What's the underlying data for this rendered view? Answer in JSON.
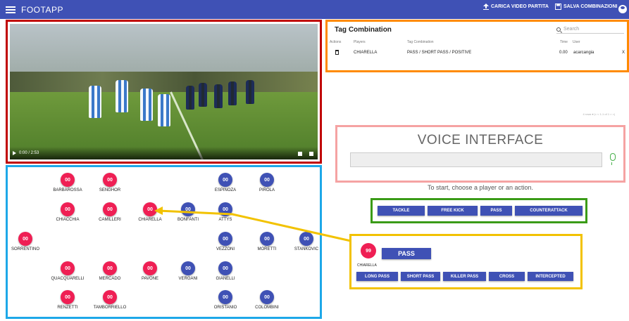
{
  "app": {
    "title": "FOOTAPP",
    "upload_label": "CARICA VIDEO PARTITA",
    "save_label": "SALVA COMBINAZIONI"
  },
  "video": {
    "time": "0:00 / 2:53"
  },
  "tag_table": {
    "title": "Tag Combination",
    "search_placeholder": "Search",
    "columns": {
      "actions": "Actions",
      "players": "Players",
      "tag": "Tag Combination",
      "time": "Time",
      "user": "User"
    },
    "rows": [
      {
        "player": "CHIARELLA",
        "tag": "PASS / SHORT PASS / POSITIVE",
        "time": "0.00",
        "user": "acarcangia",
        "remove": "X"
      }
    ],
    "pager": "4 rows  ▾   |<   <   1-1 of 1   >   >|"
  },
  "voice": {
    "title": "VOICE INTERFACE"
  },
  "hint": "To start, choose a player or an action.",
  "actions": [
    "TACKLE",
    "FREE KICK",
    "PASS",
    "COUNTERATTACK"
  ],
  "selection": {
    "player_number": "99",
    "player_name": "CHIARELLA",
    "action": "PASS",
    "options": [
      "LONG PASS",
      "SHORT PASS",
      "KILLER PASS",
      "CROSS",
      "INTERCEPTED"
    ]
  },
  "players": [
    {
      "num": "00",
      "name": "BARBAROSSA",
      "team": "red"
    },
    {
      "num": "00",
      "name": "SENGHOR",
      "team": "red"
    },
    {
      "num": "00",
      "name": "ESPINOZA",
      "team": "blue"
    },
    {
      "num": "00",
      "name": "PIROLA",
      "team": "blue"
    },
    {
      "num": "00",
      "name": "CHIACCHIA",
      "team": "red"
    },
    {
      "num": "00",
      "name": "CAMILLERI",
      "team": "red"
    },
    {
      "num": "00",
      "name": "CHIARELLA",
      "team": "red"
    },
    {
      "num": "00",
      "name": "BONFANTI",
      "team": "blue"
    },
    {
      "num": "00",
      "name": "ATTYS",
      "team": "blue"
    },
    {
      "num": "00",
      "name": "SORRENTINO",
      "team": "red"
    },
    {
      "num": "00",
      "name": "VEZZONI",
      "team": "blue"
    },
    {
      "num": "00",
      "name": "MORETTI",
      "team": "blue"
    },
    {
      "num": "00",
      "name": "STANKOVIC",
      "team": "blue"
    },
    {
      "num": "00",
      "name": "QUACQUARELLI",
      "team": "red"
    },
    {
      "num": "00",
      "name": "MERCADO",
      "team": "red"
    },
    {
      "num": "00",
      "name": "PAVONE",
      "team": "red"
    },
    {
      "num": "00",
      "name": "VERGANI",
      "team": "blue"
    },
    {
      "num": "00",
      "name": "GIANELLI",
      "team": "blue"
    },
    {
      "num": "00",
      "name": "RENZETTI",
      "team": "red"
    },
    {
      "num": "00",
      "name": "TAMBORRIELLO",
      "team": "red"
    },
    {
      "num": "00",
      "name": "ORISTANIO",
      "team": "blue"
    },
    {
      "num": "00",
      "name": "COLOMBINI",
      "team": "blue"
    }
  ],
  "colors": {
    "primary": "#3f51b5",
    "red_team": "#ef1f54",
    "arrow": "#f2c200"
  }
}
